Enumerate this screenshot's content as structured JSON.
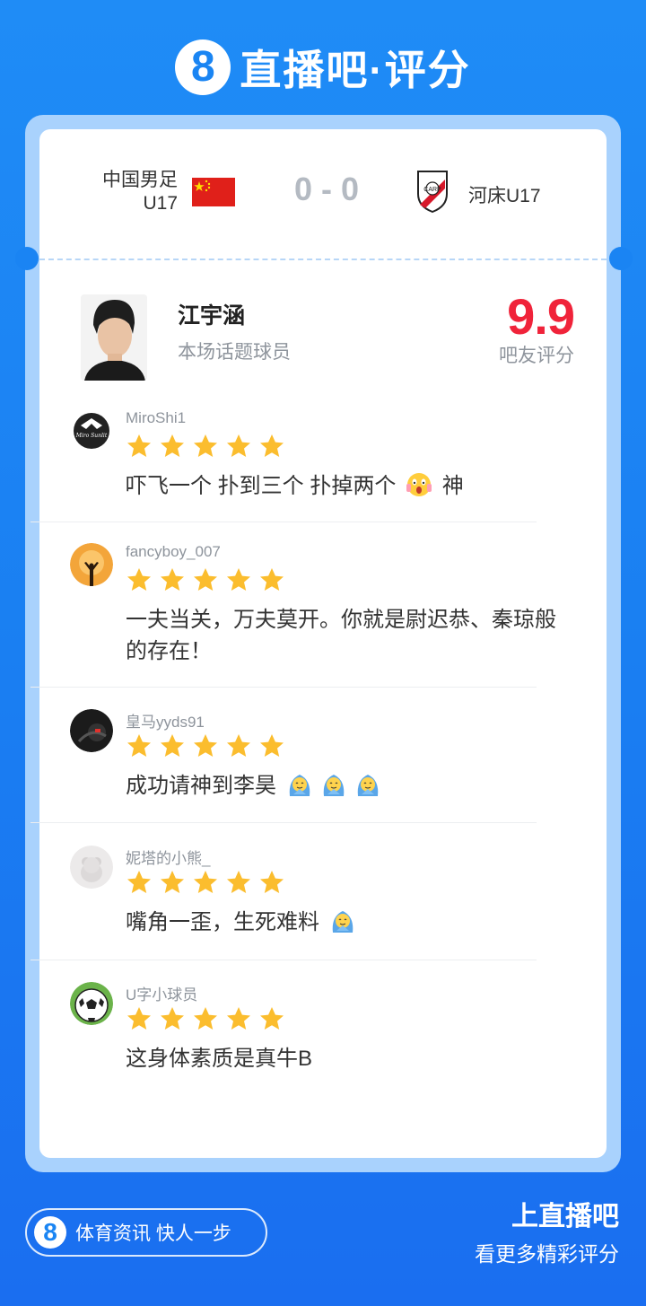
{
  "header": {
    "logo_glyph": "8",
    "title": "直播吧·评分"
  },
  "match": {
    "home": {
      "name_line1": "中国男足",
      "name_line2": "U17"
    },
    "score": "0 - 0",
    "away": {
      "name": "河床U17"
    }
  },
  "player": {
    "name": "江宇涵",
    "subtitle": "本场话题球员",
    "rating": "9.9",
    "rating_label": "吧友评分"
  },
  "comments": [
    {
      "user": "MiroShi1",
      "stars": 5,
      "text": "吓飞一个 扑到三个 扑掉两个",
      "text_tail": "神",
      "avatar_label": "Miro Sunlit"
    },
    {
      "user": "fancyboy_007",
      "stars": 5,
      "text": "一夫当关，万夫莫开。你就是尉迟恭、秦琼般的存在！"
    },
    {
      "user": "皇马yyds91",
      "stars": 5,
      "text": "成功请神到李昊"
    },
    {
      "user": "妮塔的小熊_",
      "stars": 5,
      "text": "嘴角一歪，生死难料"
    },
    {
      "user": "U字小球员",
      "stars": 5,
      "text": "这身体素质是真牛B"
    }
  ],
  "footer": {
    "logo_glyph": "8",
    "slogan": "体育资讯 快人一步",
    "cta_title": "上直播吧",
    "cta_sub": "看更多精彩评分"
  },
  "colors": {
    "brand_blue": "#1a85f3",
    "rating_red": "#f0233a",
    "star_gold": "#fbbd2e"
  }
}
